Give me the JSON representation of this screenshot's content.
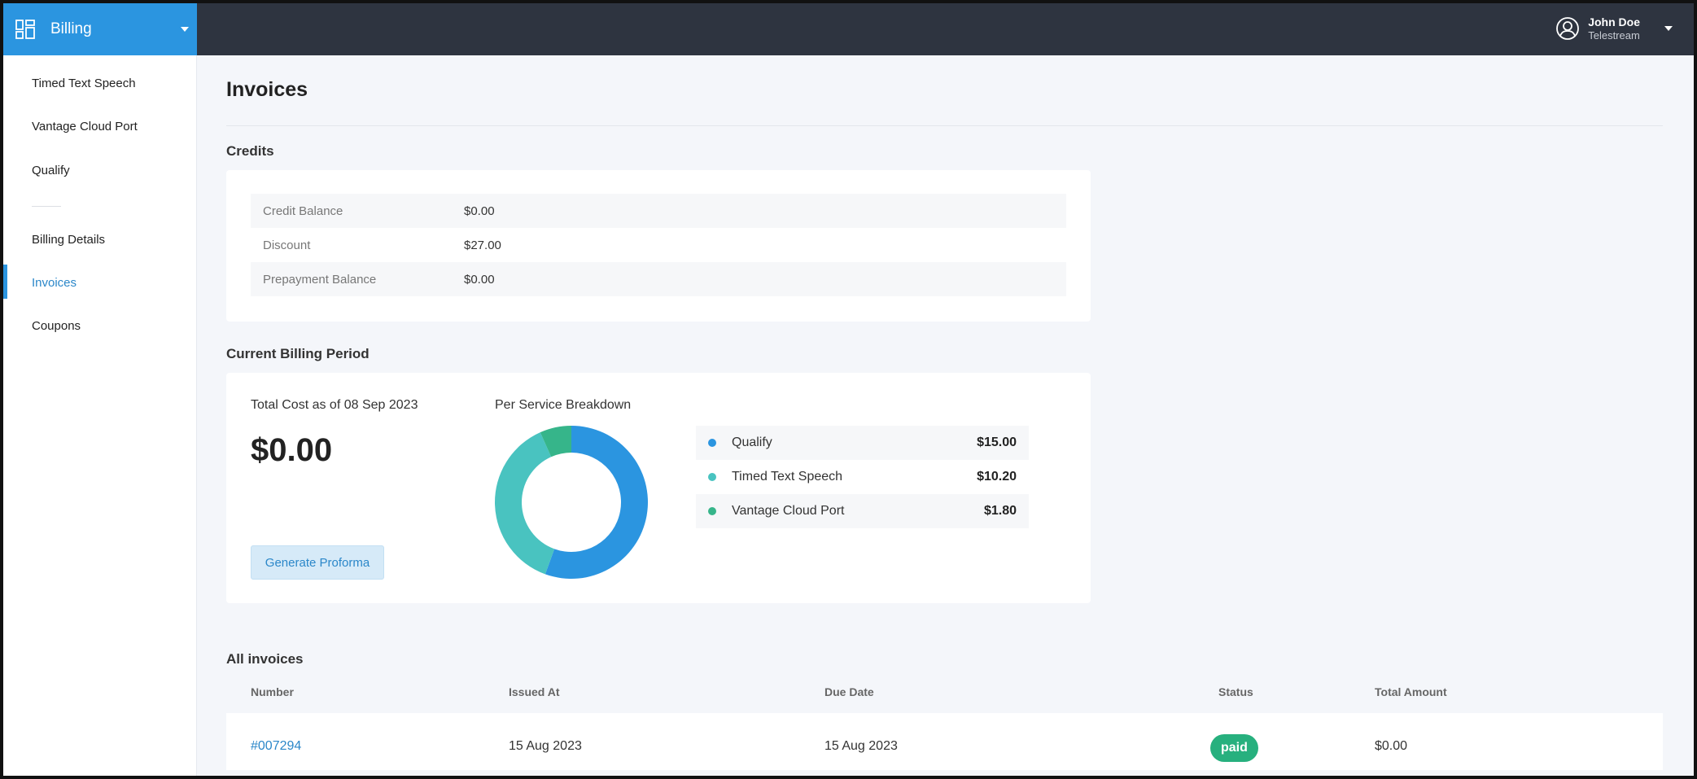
{
  "header": {
    "brand_label": "Billing",
    "brand_icon": "dashboard-grid-icon",
    "user_name": "John Doe",
    "user_org": "Telestream",
    "user_icon": "user-circle-icon"
  },
  "sidebar": {
    "items": [
      {
        "label": "Timed Text Speech"
      },
      {
        "label": "Vantage Cloud Port"
      },
      {
        "label": "Qualify"
      },
      {
        "label": "Billing Details"
      },
      {
        "label": "Invoices",
        "active": true
      },
      {
        "label": "Coupons"
      }
    ]
  },
  "page": {
    "title": "Invoices"
  },
  "credits": {
    "section_title": "Credits",
    "rows": [
      {
        "label": "Credit Balance",
        "value": "$0.00"
      },
      {
        "label": "Discount",
        "value": "$27.00"
      },
      {
        "label": "Prepayment Balance",
        "value": "$0.00"
      }
    ]
  },
  "billing_period": {
    "section_title": "Current Billing Period",
    "cost_label": "Total Cost as of 08 Sep 2023",
    "cost_value": "$0.00",
    "generate_button": "Generate Proforma",
    "breakdown_label": "Per Service Breakdown"
  },
  "chart_data": {
    "type": "pie",
    "categories": [
      "Qualify",
      "Timed Text Speech",
      "Vantage Cloud Port"
    ],
    "values": [
      15.0,
      10.2,
      1.8
    ],
    "value_labels": [
      "$15.00",
      "$10.20",
      "$1.80"
    ],
    "colors": [
      "#2b95e0",
      "#49c3c0",
      "#36b58a"
    ],
    "title": "Per Service Breakdown",
    "donut": true
  },
  "invoices": {
    "section_title": "All invoices",
    "columns": [
      "Number",
      "Issued At",
      "Due Date",
      "Status",
      "Total Amount"
    ],
    "rows": [
      {
        "number": "#007294",
        "issued_at": "15 Aug 2023",
        "due_date": "15 Aug 2023",
        "status": "paid",
        "total": "$0.00"
      }
    ]
  },
  "colors": {
    "accent": "#2b95e0",
    "topbar": "#2e3440",
    "paid": "#27b07e"
  }
}
